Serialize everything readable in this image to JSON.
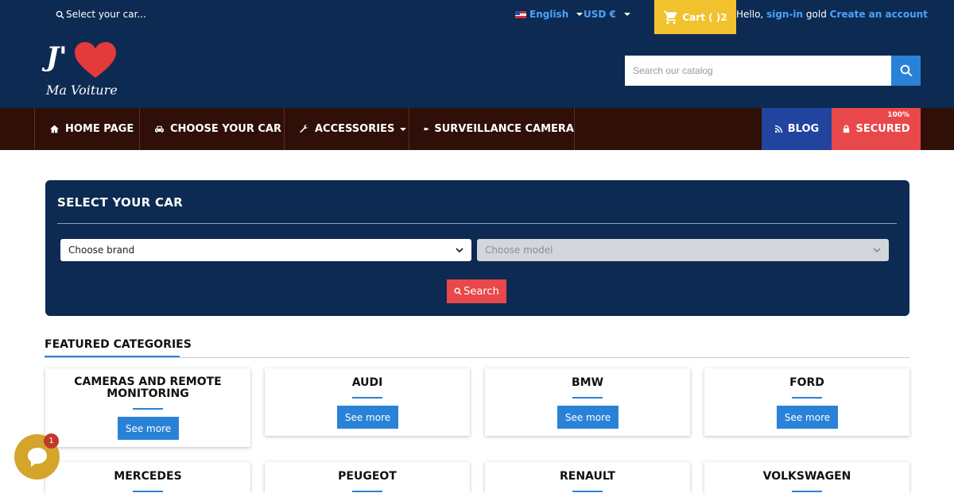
{
  "topbar": {
    "select_car": "Select your car...",
    "language": "English",
    "currency": "USD €",
    "cart_label": "Cart ( )2",
    "hello": "Hello,",
    "sign_in": "sign-in",
    "user": "gold",
    "create_account": "Create an account"
  },
  "logo": {
    "initial": "J'",
    "tagline": "Ma Voiture"
  },
  "search": {
    "placeholder": "Search our catalog"
  },
  "nav": {
    "home": "HOME PAGE",
    "choose_car": "CHOOSE YOUR CAR",
    "accessories": "ACCESSORIES",
    "camera": "SURVEILLANCE CAMERA",
    "blog": "BLOG",
    "secured": "SECURED",
    "secured_pct": "100%"
  },
  "car_selector": {
    "title": "SELECT YOUR CAR",
    "brand_value": "Choose brand",
    "model_value": "Choose model",
    "search_button": "Search"
  },
  "featured": {
    "title": "FEATURED CATEGORIES",
    "see_more": "See more",
    "categories": [
      "CAMERAS AND REMOTE MONITORING",
      "AUDI",
      "BMW",
      "FORD",
      "MERCEDES",
      "PEUGEOT",
      "RENAULT",
      "VOLKSWAGEN"
    ]
  },
  "chat": {
    "badge": "1"
  },
  "colors": {
    "header": "#0d2a52",
    "nav": "#2f0f07",
    "accent_blue": "#2a82d8",
    "accent_red": "#e9484a",
    "cart_yellow": "#f2c12e"
  }
}
